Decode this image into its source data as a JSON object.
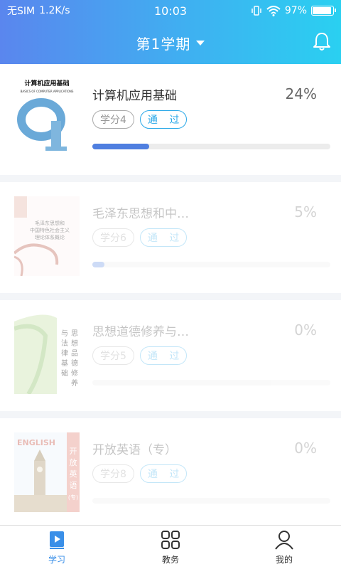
{
  "status": {
    "carrier": "无SIM",
    "speed": "1.2K/s",
    "time": "10:03",
    "battery": "97%"
  },
  "header": {
    "title": "第1学期"
  },
  "courses": [
    {
      "name": "计算机应用基础",
      "percent": "24%",
      "progress": 0.24,
      "credit": "学分4",
      "status": "通 过",
      "cover_title": "计算机应用基础",
      "cover_subtitle": "BASICS OF COMPUTER APPLICATIONS"
    },
    {
      "name": "毛泽东思想和中…",
      "percent": "5%",
      "progress": 0.05,
      "credit": "学分6",
      "status": "通 过",
      "cover_title": "毛泽东思想和\n中国特色社会主义\n理论体系概论"
    },
    {
      "name": "思想道德修养与…",
      "percent": "0%",
      "progress": 0.0,
      "credit": "学分5",
      "status": "通 过",
      "cover_title": "思想道德修养与法律基础"
    },
    {
      "name": "开放英语（专）",
      "percent": "0%",
      "progress": 0.0,
      "credit": "学分8",
      "status": "通 过",
      "cover_title": "开放英语",
      "cover_english": "ENGLISH",
      "cover_sub": "(专)"
    }
  ],
  "tabs": [
    {
      "label": "学习",
      "icon": "study-icon",
      "active": true
    },
    {
      "label": "教务",
      "icon": "grid-icon",
      "active": false
    },
    {
      "label": "我的",
      "icon": "user-icon",
      "active": false
    }
  ],
  "colors": {
    "accent": "#3a8fe8",
    "progress": "#4f7fe0",
    "pass": "#2aa8e8"
  }
}
